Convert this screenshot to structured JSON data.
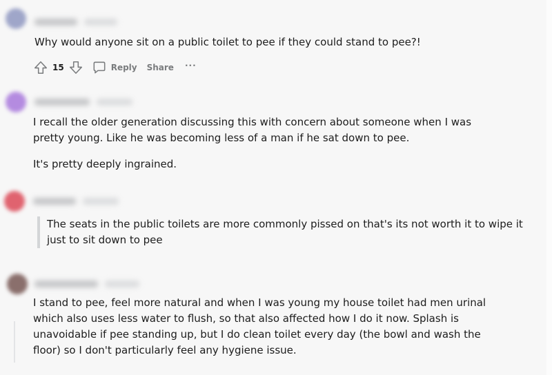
{
  "comments": [
    {
      "avatar_color": "#9fa6c9",
      "body": [
        "Why would anyone sit on a public toilet to pee if they could stand to pee?!"
      ],
      "actions": {
        "score": "15",
        "reply_label": "Reply",
        "share_label": "Share",
        "more_label": "···"
      }
    },
    {
      "avatar_color": "#b48be0",
      "body": [
        "I recall the older generation discussing this with concern about someone when I was pretty young. Like he was becoming less of a man if he sat down to pee.",
        "It's pretty deeply ingrained."
      ]
    },
    {
      "avatar_color": "#e0636f",
      "quote": "The seats in the public toilets are more commonly pissed on that's its not worth it to wipe it just to sit down to pee"
    },
    {
      "avatar_color": "#8a6f6c",
      "body": [
        "I stand to pee, feel more natural and when I was young my house toilet had men urinal which also uses less water to flush, so that also affected how I do it now. Splash is unavoidable if pee standing up, but I do clean toilet every day (the bowl and wash the floor) so I don't particularly feel any hygiene issue."
      ]
    }
  ],
  "colors": {
    "text": "#1c1c1c",
    "action_gray": "#7a7c7e",
    "quote_bar": "#d3d5d7",
    "background": "#f7f7f7"
  }
}
